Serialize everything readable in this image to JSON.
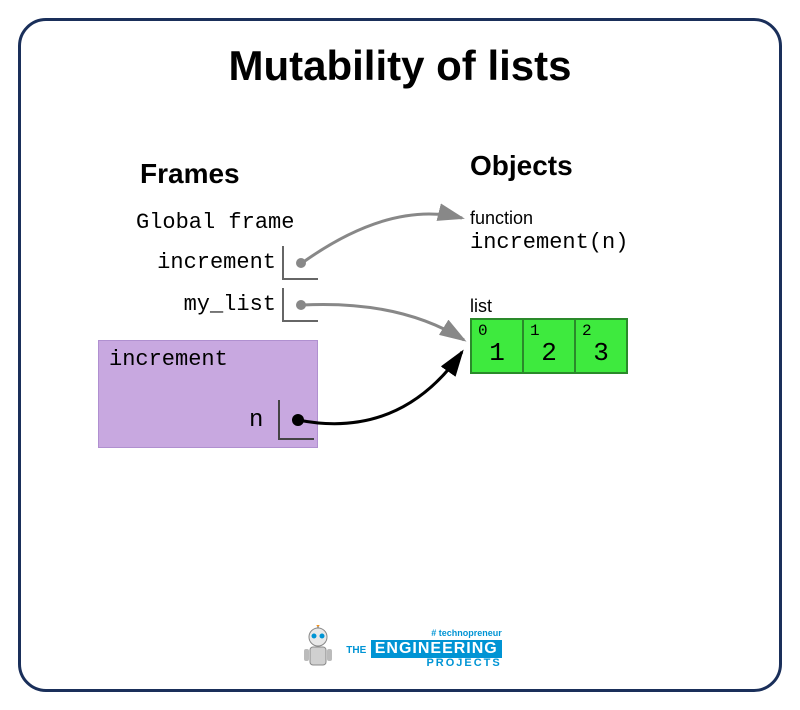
{
  "title": "Mutability of lists",
  "columns": {
    "frames": "Frames",
    "objects": "Objects"
  },
  "global_frame": {
    "label": "Global frame",
    "vars": {
      "increment": "increment",
      "my_list": "my_list"
    }
  },
  "call_frame": {
    "name": "increment",
    "vars": {
      "n": "n"
    }
  },
  "objects": {
    "function": {
      "kind": "function",
      "signature": "increment(n)"
    },
    "list": {
      "kind": "list",
      "cells": [
        {
          "index": "0",
          "value": "1"
        },
        {
          "index": "1",
          "value": "2"
        },
        {
          "index": "2",
          "value": "3"
        }
      ]
    }
  },
  "footer": {
    "tag": "# technopreneur",
    "the": "THE",
    "eng": "ENGINEERING",
    "proj": "PROJECTS"
  }
}
